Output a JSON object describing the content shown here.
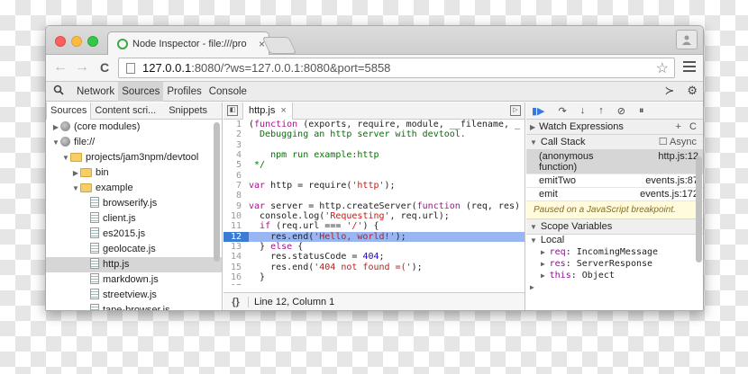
{
  "browser": {
    "tab_title": "Node Inspector - file:///pro",
    "tab_close": "×",
    "profile_icon": "person-icon",
    "url_host": "127.0.0.1",
    "url_rest": ":8080/?ws=127.0.0.1:8080&port=5858",
    "back": "←",
    "forward": "→",
    "reload": "C",
    "star": "☆"
  },
  "devtools": {
    "tabs": [
      "Network",
      "Sources",
      "Profiles",
      "Console"
    ],
    "active_tab": "Sources",
    "navigator_tabs": [
      "Sources",
      "Content scri...",
      "Snippets"
    ],
    "tree": [
      {
        "label": "(core modules)",
        "icon": "globe-icon",
        "arrow": "▶",
        "indent": 0
      },
      {
        "label": "file://",
        "icon": "globe-icon",
        "arrow": "▼",
        "indent": 0
      },
      {
        "label": "projects/jam3npm/devtool",
        "icon": "folder-icon",
        "arrow": "▼",
        "indent": 1
      },
      {
        "label": "bin",
        "icon": "folder-icon",
        "arrow": "▶",
        "indent": 2
      },
      {
        "label": "example",
        "icon": "folder-icon",
        "arrow": "▼",
        "indent": 2
      },
      {
        "label": "browserify.js",
        "icon": "file-icon",
        "arrow": "",
        "indent": 3
      },
      {
        "label": "client.js",
        "icon": "file-icon",
        "arrow": "",
        "indent": 3
      },
      {
        "label": "es2015.js",
        "icon": "file-icon",
        "arrow": "",
        "indent": 3
      },
      {
        "label": "geolocate.js",
        "icon": "file-icon",
        "arrow": "",
        "indent": 3
      },
      {
        "label": "http.js",
        "icon": "file-icon",
        "arrow": "",
        "indent": 3,
        "selected": true
      },
      {
        "label": "markdown.js",
        "icon": "file-icon",
        "arrow": "",
        "indent": 3
      },
      {
        "label": "streetview.js",
        "icon": "file-icon",
        "arrow": "",
        "indent": 3
      },
      {
        "label": "tape-browser.js",
        "icon": "file-icon",
        "arrow": "",
        "indent": 3
      }
    ],
    "editor": {
      "file_tab": "http.js",
      "status": "Line 12, Column 1",
      "braces": "{}",
      "current_line": 12,
      "lines": [
        [
          {
            "t": "(",
            "c": ""
          },
          {
            "t": "function",
            "c": "kw"
          },
          {
            "t": " (exports, require, module, __filename, _",
            "c": ""
          }
        ],
        [
          {
            "t": "  Debugging an http server with devtool.",
            "c": "com"
          }
        ],
        [
          {
            "t": "",
            "c": ""
          }
        ],
        [
          {
            "t": "    npm run example:http",
            "c": "com"
          }
        ],
        [
          {
            "t": " */",
            "c": "com"
          }
        ],
        [
          {
            "t": "",
            "c": ""
          }
        ],
        [
          {
            "t": "var",
            "c": "kw"
          },
          {
            "t": " http = require(",
            "c": ""
          },
          {
            "t": "'http'",
            "c": "str"
          },
          {
            "t": ");",
            "c": ""
          }
        ],
        [
          {
            "t": "",
            "c": ""
          }
        ],
        [
          {
            "t": "var",
            "c": "kw"
          },
          {
            "t": " server = http.createServer(",
            "c": ""
          },
          {
            "t": "function",
            "c": "kw"
          },
          {
            "t": " (req, res)",
            "c": ""
          }
        ],
        [
          {
            "t": "  console.log(",
            "c": ""
          },
          {
            "t": "'Requesting'",
            "c": "str"
          },
          {
            "t": ", req.url);",
            "c": ""
          }
        ],
        [
          {
            "t": "  ",
            "c": ""
          },
          {
            "t": "if",
            "c": "kw"
          },
          {
            "t": " (req.url === ",
            "c": ""
          },
          {
            "t": "'/'",
            "c": "str"
          },
          {
            "t": ") {",
            "c": ""
          }
        ],
        [
          {
            "t": "    res.end(",
            "c": ""
          },
          {
            "t": "'Hello, world!'",
            "c": "str"
          },
          {
            "t": ");",
            "c": ""
          }
        ],
        [
          {
            "t": "  } ",
            "c": ""
          },
          {
            "t": "else",
            "c": "kw"
          },
          {
            "t": " {",
            "c": ""
          }
        ],
        [
          {
            "t": "    res.statusCode = ",
            "c": ""
          },
          {
            "t": "404",
            "c": "num"
          },
          {
            "t": ";",
            "c": ""
          }
        ],
        [
          {
            "t": "    res.end(",
            "c": ""
          },
          {
            "t": "'404 not found =('",
            "c": "str"
          },
          {
            "t": ");",
            "c": ""
          }
        ],
        [
          {
            "t": "  }",
            "c": ""
          }
        ],
        [
          {
            "t": "  ",
            "c": ""
          }
        ]
      ]
    },
    "sidebar": {
      "watch_title": "Watch Expressions",
      "watch_add": "+",
      "watch_refresh": "C",
      "callstack_title": "Call Stack",
      "async_label": "Async",
      "stack": [
        {
          "fn": "(anonymous function)",
          "loc": "http.js:12",
          "selected": true
        },
        {
          "fn": "emitTwo",
          "loc": "events.js:87"
        },
        {
          "fn": "emit",
          "loc": "events.js:172"
        }
      ],
      "paused_msg": "Paused on a JavaScript breakpoint.",
      "scope_title": "Scope Variables",
      "local_title": "Local",
      "scope_vars": [
        {
          "k": "req",
          "v": ": IncomingMessage"
        },
        {
          "k": "res",
          "v": ": ServerResponse"
        },
        {
          "k": "this",
          "v": ": Object"
        }
      ]
    }
  }
}
